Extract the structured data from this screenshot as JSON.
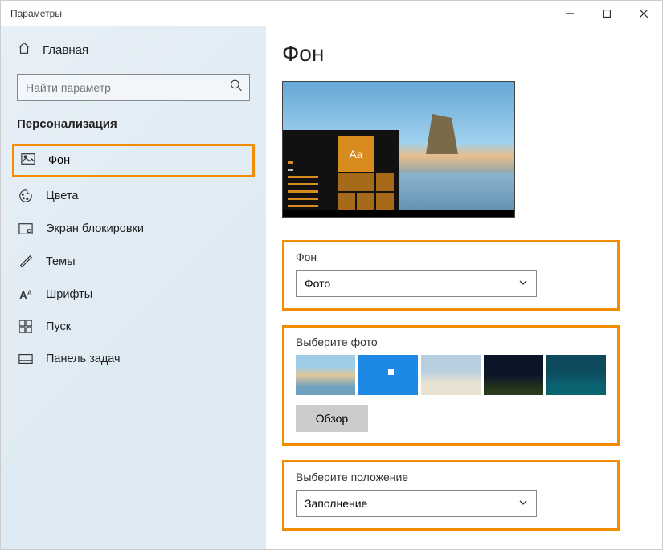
{
  "window": {
    "title": "Параметры"
  },
  "sidebar": {
    "home_label": "Главная",
    "search_placeholder": "Найти параметр",
    "section_title": "Персонализация",
    "items": [
      {
        "label": "Фон"
      },
      {
        "label": "Цвета"
      },
      {
        "label": "Экран блокировки"
      },
      {
        "label": "Темы"
      },
      {
        "label": "Шрифты"
      },
      {
        "label": "Пуск"
      },
      {
        "label": "Панель задач"
      }
    ]
  },
  "main": {
    "page_title": "Фон",
    "preview_tile_text": "Aa",
    "bg_section_label": "Фон",
    "bg_dropdown_value": "Фото",
    "photo_section_label": "Выберите фото",
    "browse_label": "Обзор",
    "position_section_label": "Выберите положение",
    "position_dropdown_value": "Заполнение"
  }
}
